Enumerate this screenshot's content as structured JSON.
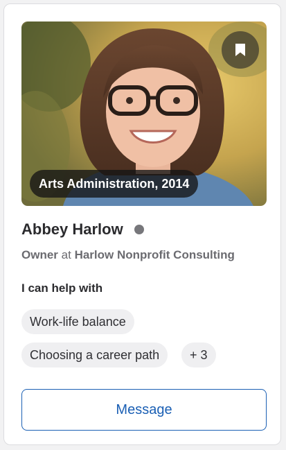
{
  "profile": {
    "name": "Abbey Harlow",
    "program_badge": "Arts Administration, 2014",
    "role_title": "Owner",
    "role_connector": "at",
    "organization": "Harlow Nonprofit Consulting",
    "status": "offline"
  },
  "help": {
    "heading": "I can help with",
    "topics": [
      "Work-life balance",
      "Choosing a career path"
    ],
    "more_label": "+ 3"
  },
  "actions": {
    "message_label": "Message"
  },
  "icons": {
    "bookmark": "bookmark-icon",
    "status": "status-dot"
  },
  "colors": {
    "accent": "#1a5fb4",
    "status_dot": "#77777b",
    "chip_bg": "#efeff1"
  }
}
